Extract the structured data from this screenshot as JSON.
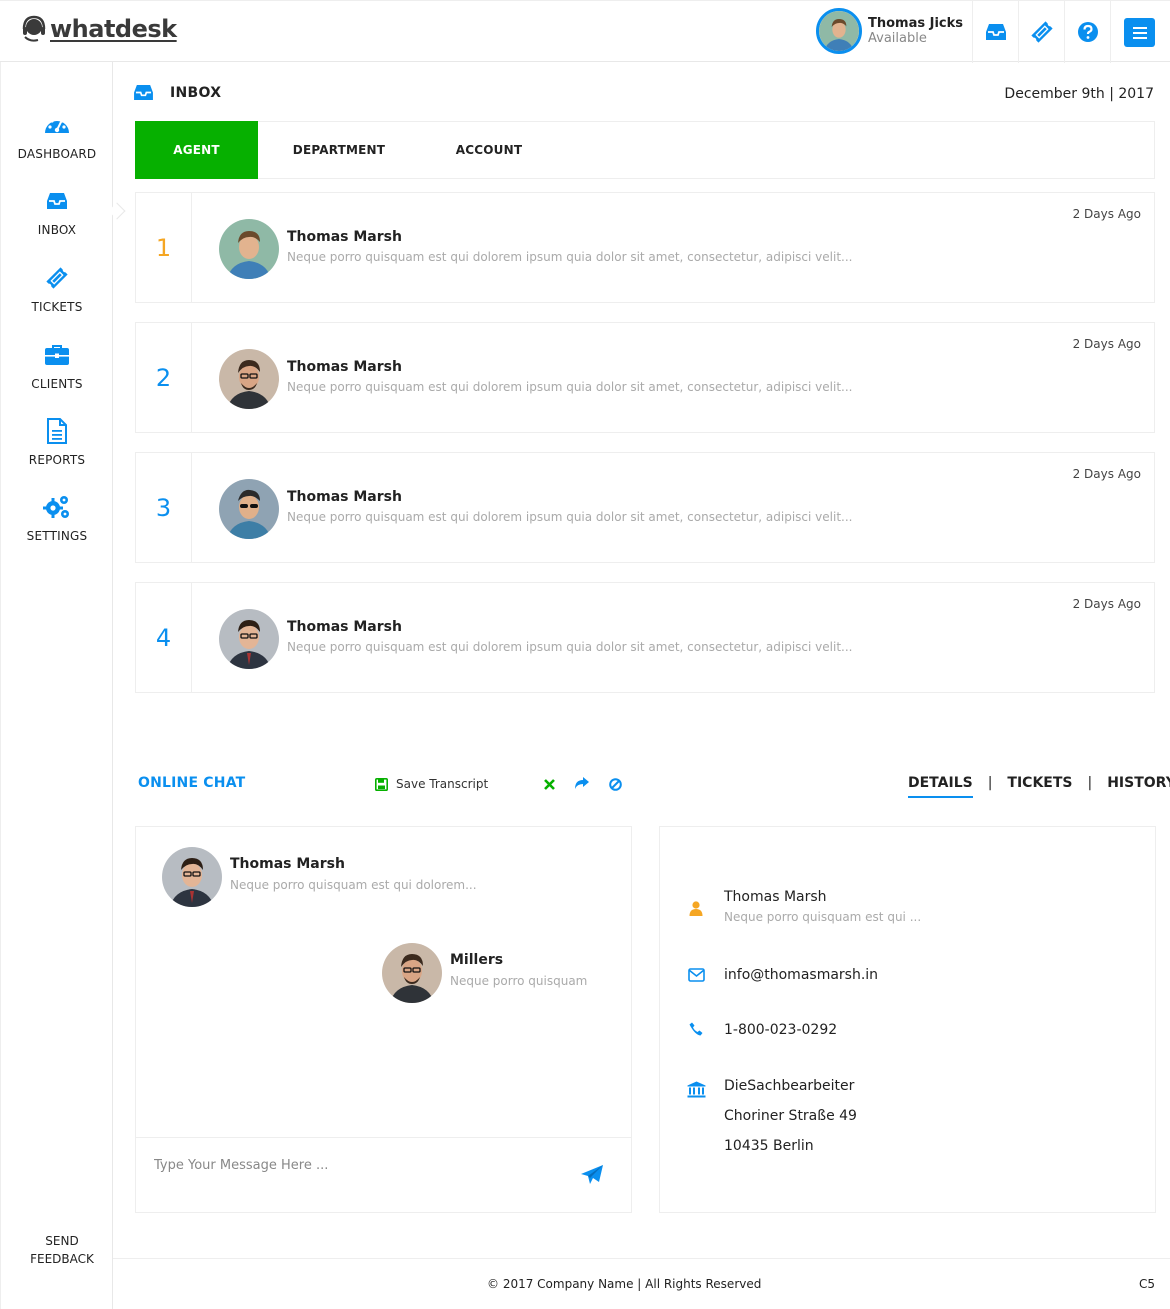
{
  "header": {
    "logo_text": "whatdesk",
    "user_name": "Thomas Jicks",
    "user_status": "Available"
  },
  "icons": {
    "logo": "headset-icon",
    "inbox": "inbox-icon",
    "tickets": "ticket-icon",
    "help": "question-icon",
    "menu": "menu-icon"
  },
  "colors": {
    "accent": "#0a8fef",
    "active_tab": "#06b000",
    "number_highlight": "#f5a623"
  },
  "sidebar": {
    "items": [
      {
        "label": "DASHBOARD",
        "icon": "dashboard-icon"
      },
      {
        "label": "INBOX",
        "icon": "inbox-icon"
      },
      {
        "label": "TICKETS",
        "icon": "ticket-icon"
      },
      {
        "label": "CLIENTS",
        "icon": "briefcase-icon"
      },
      {
        "label": "REPORTS",
        "icon": "document-icon"
      },
      {
        "label": "SETTINGS",
        "icon": "cogs-icon"
      }
    ],
    "feedback_line1": "SEND",
    "feedback_line2": "FEEDBACK"
  },
  "inbox": {
    "title": "INBOX",
    "date": "December 9th | 2017",
    "tabs": [
      "AGENT",
      "DEPARTMENT",
      "ACCOUNT"
    ],
    "messages": [
      {
        "num": "1",
        "name": "Thomas Marsh",
        "text": "Neque porro quisquam est qui dolorem ipsum quia dolor sit amet, consectetur, adipisci velit...",
        "time": "2 Days Ago"
      },
      {
        "num": "2",
        "name": "Thomas Marsh",
        "text": "Neque porro quisquam est qui dolorem ipsum quia dolor sit amet, consectetur, adipisci velit...",
        "time": "2 Days Ago"
      },
      {
        "num": "3",
        "name": "Thomas Marsh",
        "text": "Neque porro quisquam est qui dolorem ipsum quia dolor sit amet, consectetur, adipisci velit...",
        "time": "2 Days Ago"
      },
      {
        "num": "4",
        "name": "Thomas Marsh",
        "text": "Neque porro quisquam est qui dolorem ipsum quia dolor sit amet, consectetur, adipisci velit...",
        "time": "2 Days Ago"
      }
    ]
  },
  "chat": {
    "title": "ONLINE CHAT",
    "save_transcript": "Save Transcript",
    "messages": [
      {
        "name": "Thomas Marsh",
        "text": "Neque porro quisquam est qui dolorem..."
      },
      {
        "name": "Millers",
        "text": "Neque porro quisquam"
      }
    ],
    "input_placeholder": "Type Your Message Here ..."
  },
  "details": {
    "tabs": [
      "DETAILS",
      "TICKETS",
      "HISTORY"
    ],
    "separator": "|",
    "name": "Thomas Marsh",
    "name_sub": "Neque porro quisquam est qui ...",
    "email": "info@thomasmarsh.in",
    "phone": "1-800-023-0292",
    "address": [
      "DieSachbearbeiter",
      "Choriner Straße 49",
      "10435 Berlin"
    ]
  },
  "footer": {
    "copyright": "© 2017 Company Name  | All Rights Reserved",
    "code": "C5"
  }
}
